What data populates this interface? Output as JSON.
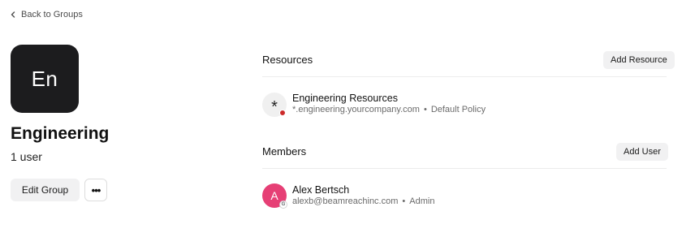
{
  "nav": {
    "back_label": "Back to Groups"
  },
  "group": {
    "initials": "En",
    "name": "Engineering",
    "member_count": "1 user",
    "edit_label": "Edit Group",
    "more_label": "•••"
  },
  "resources": {
    "title": "Resources",
    "add_label": "Add Resource",
    "items": [
      {
        "icon": "*",
        "name": "Engineering Resources",
        "address": "*.engineering.yourcompany.com",
        "separator": "•",
        "policy": "Default Policy",
        "status_color": "#cc2b2b"
      }
    ]
  },
  "members": {
    "title": "Members",
    "add_label": "Add User",
    "items": [
      {
        "initial": "A",
        "name": "Alex Bertsch",
        "email": "alexb@beamreachinc.com",
        "separator": "•",
        "role": "Admin",
        "badge": "G",
        "avatar_color": "#e63f75"
      }
    ]
  }
}
